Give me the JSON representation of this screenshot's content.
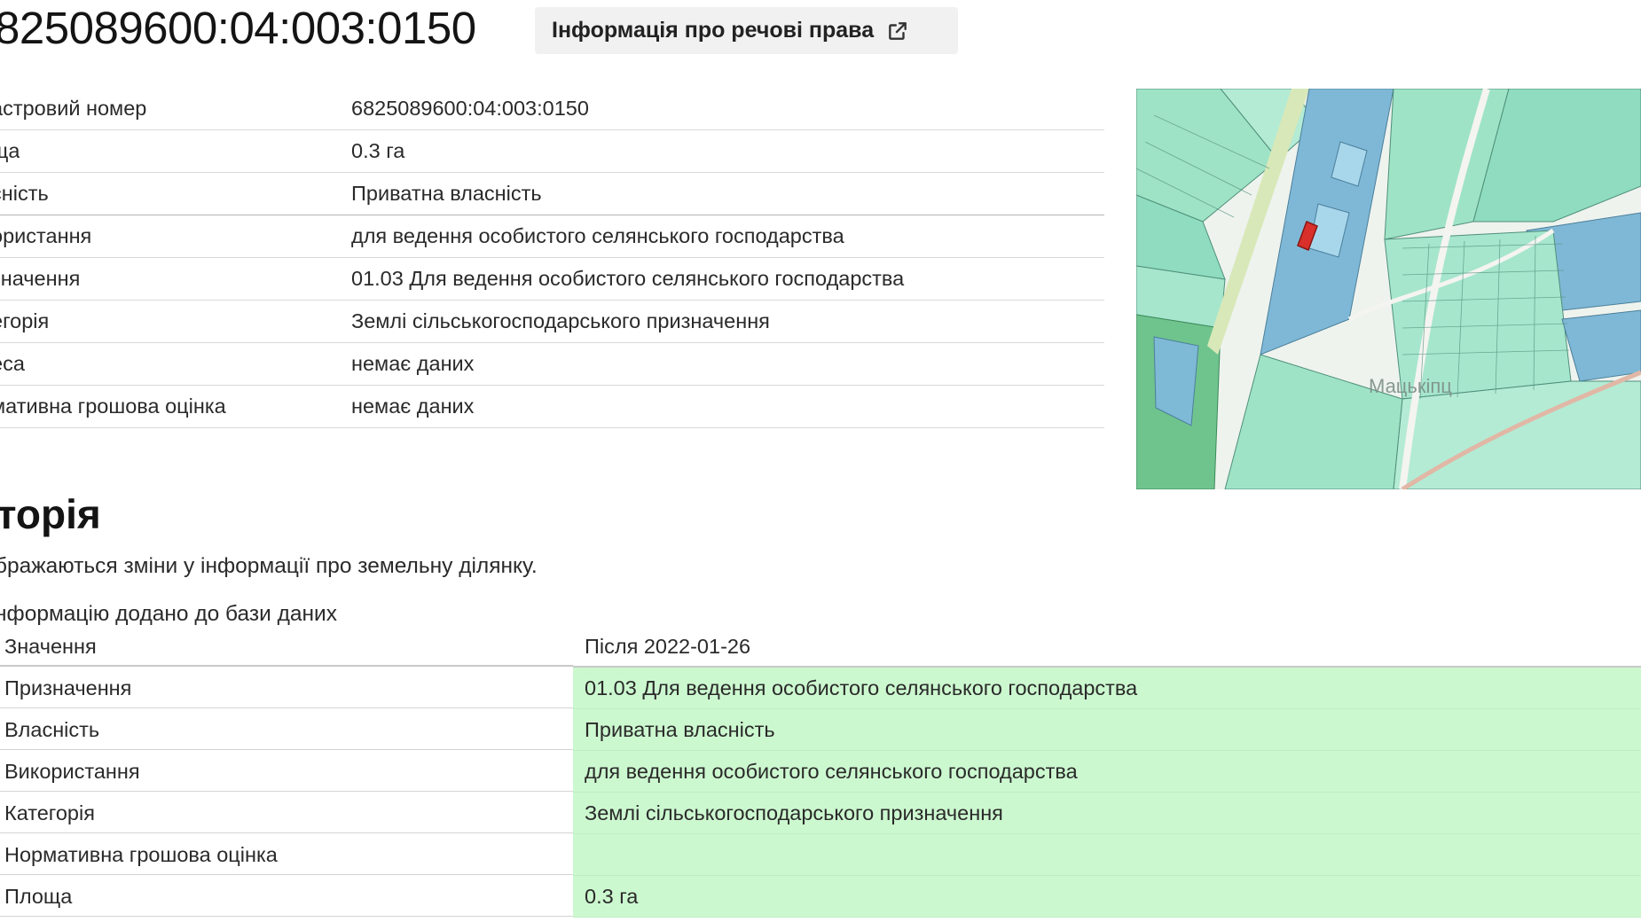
{
  "header": {
    "title": "825089600:04:003:0150",
    "rights_button_label": "Інформація про речові права"
  },
  "info": {
    "rows": [
      {
        "label": "астровий номер",
        "value": "6825089600:04:003:0150"
      },
      {
        "label": "ща",
        "value": "0.3 га"
      },
      {
        "label": "сність",
        "value": "Приватна власність"
      },
      {
        "label": "ористання",
        "value": "для ведення особистого селянського господарства"
      },
      {
        "label": "значення",
        "value": "01.03 Для ведення особистого селянського господарства"
      },
      {
        "label": "егорія",
        "value": "Землі сільськогосподарського призначення"
      },
      {
        "label": "еса",
        "value": "немає даних"
      },
      {
        "label": "мативна грошова оцінка",
        "value": "немає даних"
      }
    ]
  },
  "map": {
    "place_label": "Мацькіпц"
  },
  "history": {
    "heading": "торія",
    "description": "бражаються зміни у інформації про земельну ділянку.",
    "event_title": "нформацію додано до бази даних",
    "col_value": "Значення",
    "col_after": "Після 2022-01-26",
    "rows": [
      {
        "field": "Призначення",
        "after": "01.03 Для ведення особистого селянського господарства"
      },
      {
        "field": "Власність",
        "after": "Приватна власність"
      },
      {
        "field": "Використання",
        "after": "для ведення особистого селянського господарства"
      },
      {
        "field": "Категорія",
        "after": "Землі сільськогосподарського призначення"
      },
      {
        "field": "Нормативна грошова оцінка",
        "after": ""
      },
      {
        "field": "Площа",
        "after": "0.3 га"
      }
    ]
  },
  "colors": {
    "changed_bg": "#ccf8cf",
    "parcel_highlight": "#d9302b",
    "parcel_fill": "#9fe3c6",
    "parcel_fill_blue": "#7fb8d6"
  }
}
